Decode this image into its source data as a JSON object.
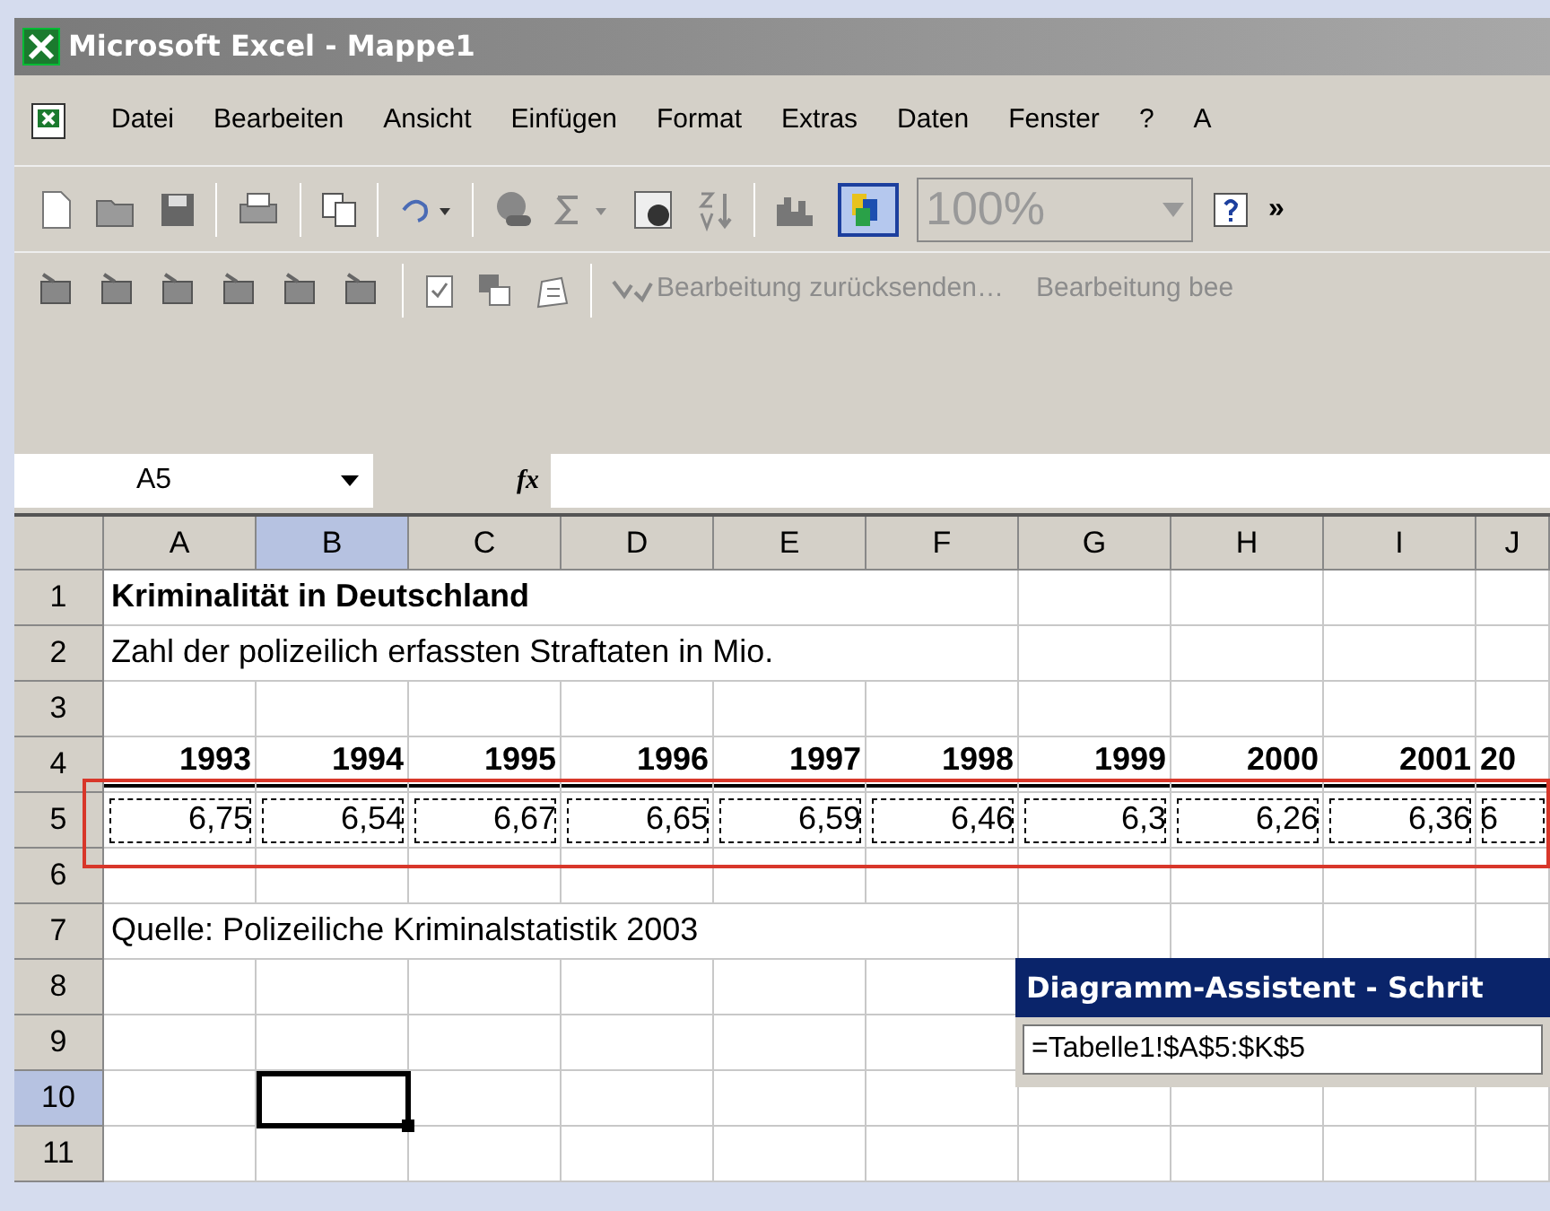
{
  "window": {
    "title": "Microsoft Excel - Mappe1"
  },
  "menu": [
    "Datei",
    "Bearbeiten",
    "Ansicht",
    "Einfügen",
    "Format",
    "Extras",
    "Daten",
    "Fenster",
    "?",
    "A"
  ],
  "standard_toolbar": {
    "zoom": "100%",
    "overflow": "»"
  },
  "review_toolbar": {
    "commands": [
      "Bearbeitung zurücksenden…",
      "Bearbeitung bee"
    ]
  },
  "formula_bar": {
    "name_box": "A5",
    "fx": "fx"
  },
  "sheet": {
    "columns": [
      {
        "label": "A",
        "selected": false
      },
      {
        "label": "B",
        "selected": true
      },
      {
        "label": "C",
        "selected": false
      },
      {
        "label": "D",
        "selected": false
      },
      {
        "label": "E",
        "selected": false
      },
      {
        "label": "F",
        "selected": false
      },
      {
        "label": "G",
        "selected": false
      },
      {
        "label": "H",
        "selected": false
      },
      {
        "label": "I",
        "selected": false
      },
      {
        "label": "J",
        "selected": false
      }
    ],
    "rows": [
      {
        "label": "1",
        "selected": false,
        "cells": [
          {
            "kind": "title",
            "text": "Kriminalität in Deutschland"
          }
        ]
      },
      {
        "label": "2",
        "selected": false,
        "cells": [
          {
            "kind": "text",
            "text": "Zahl der polizeilich erfassten Straftaten in Mio."
          }
        ]
      },
      {
        "label": "3",
        "selected": false,
        "cells": []
      },
      {
        "label": "4",
        "selected": false,
        "cells": [
          {
            "kind": "year",
            "text": "1993"
          },
          {
            "kind": "year",
            "text": "1994"
          },
          {
            "kind": "year",
            "text": "1995"
          },
          {
            "kind": "year",
            "text": "1996"
          },
          {
            "kind": "year",
            "text": "1997"
          },
          {
            "kind": "year",
            "text": "1998"
          },
          {
            "kind": "year",
            "text": "1999"
          },
          {
            "kind": "year",
            "text": "2000"
          },
          {
            "kind": "year",
            "text": "2001"
          },
          {
            "kind": "year",
            "text": "20"
          }
        ]
      },
      {
        "label": "5",
        "selected": false,
        "cells": [
          {
            "kind": "value",
            "text": "6,75"
          },
          {
            "kind": "value",
            "text": "6,54"
          },
          {
            "kind": "value",
            "text": "6,67"
          },
          {
            "kind": "value",
            "text": "6,65"
          },
          {
            "kind": "value",
            "text": "6,59"
          },
          {
            "kind": "value",
            "text": "6,46"
          },
          {
            "kind": "value",
            "text": "6,3"
          },
          {
            "kind": "value",
            "text": "6,26"
          },
          {
            "kind": "value",
            "text": "6,36"
          },
          {
            "kind": "value",
            "text": "6"
          }
        ]
      },
      {
        "label": "6",
        "selected": false,
        "cells": []
      },
      {
        "label": "7",
        "selected": false,
        "cells": [
          {
            "kind": "text",
            "text": "Quelle: Polizeiliche Kriminalstatistik 2003"
          }
        ]
      },
      {
        "label": "8",
        "selected": false,
        "cells": []
      },
      {
        "label": "9",
        "selected": false,
        "cells": []
      },
      {
        "label": "10",
        "selected": true,
        "cells": []
      },
      {
        "label": "11",
        "selected": false,
        "cells": []
      }
    ]
  },
  "dialog": {
    "title": "Diagramm-Assistent - Schrit",
    "range": "=Tabelle1!$A$5:$K$5"
  }
}
